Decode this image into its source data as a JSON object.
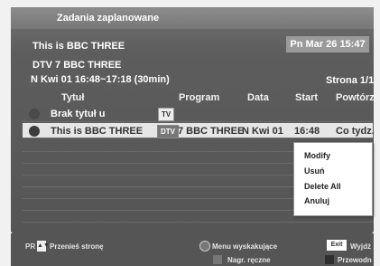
{
  "title": "Zadania zaplanowane",
  "channel_now": "This is BBC THREE",
  "datetime": "Pn Mar 26 15:47",
  "service": "DTV 7 BBC THREE",
  "schedule_info": "N Kwi 01 16:48~17:18 (30min)",
  "page": "Strona 1/1",
  "columns": {
    "title": "Tytuł",
    "program": "Program",
    "date": "Data",
    "start": "Start",
    "repeat": "Powtórz"
  },
  "rows": [
    {
      "title": "Brak tytuł u",
      "badge": "TV",
      "program": "",
      "date": "",
      "start": "",
      "repeat": ""
    },
    {
      "title": "This is BBC THREE",
      "badge": "DTV",
      "program": "7 BBC THREE",
      "date": "N Kwi 01",
      "start": "16:48",
      "repeat": "Co tydz."
    }
  ],
  "context_menu": [
    "Modify",
    "Usuń",
    "Delete All",
    "Anuluj"
  ],
  "footer": {
    "pr_label": "PR",
    "move_page": "Przenieś stronę",
    "popup_menu": "Menu wyskakujące",
    "exit_key": "Exit",
    "exit_label": "Wyjdź",
    "manual_record": "Nagr. ręczne",
    "guide": "Przewodn"
  },
  "colors": {
    "panel": "#5d5d5d",
    "highlight_row": "#e6e6e6",
    "menu_bg": "#ffffff"
  }
}
